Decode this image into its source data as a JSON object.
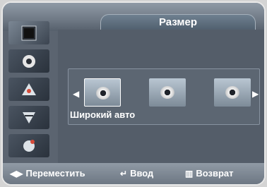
{
  "header": {
    "title": "Размер"
  },
  "left_menu": {
    "items": [
      {
        "icon": "picture-icon"
      },
      {
        "icon": "sound-icon"
      },
      {
        "icon": "channel-icon"
      },
      {
        "icon": "setup-icon"
      },
      {
        "icon": "input-icon"
      }
    ]
  },
  "size_options": {
    "selected_label": "Широкий авто",
    "thumbnails": [
      {
        "icon": "wide-auto-icon",
        "selected": true
      },
      {
        "icon": "16-9-icon",
        "selected": false
      },
      {
        "icon": "zoom-icon",
        "selected": false
      }
    ]
  },
  "bottom_bar": {
    "move_label": "Переместить",
    "enter_label": "Ввод",
    "return_label": "Возврат"
  },
  "colors": {
    "frame": "#e9e9e9",
    "panel": "#5b6470",
    "text": "#ffffff"
  }
}
